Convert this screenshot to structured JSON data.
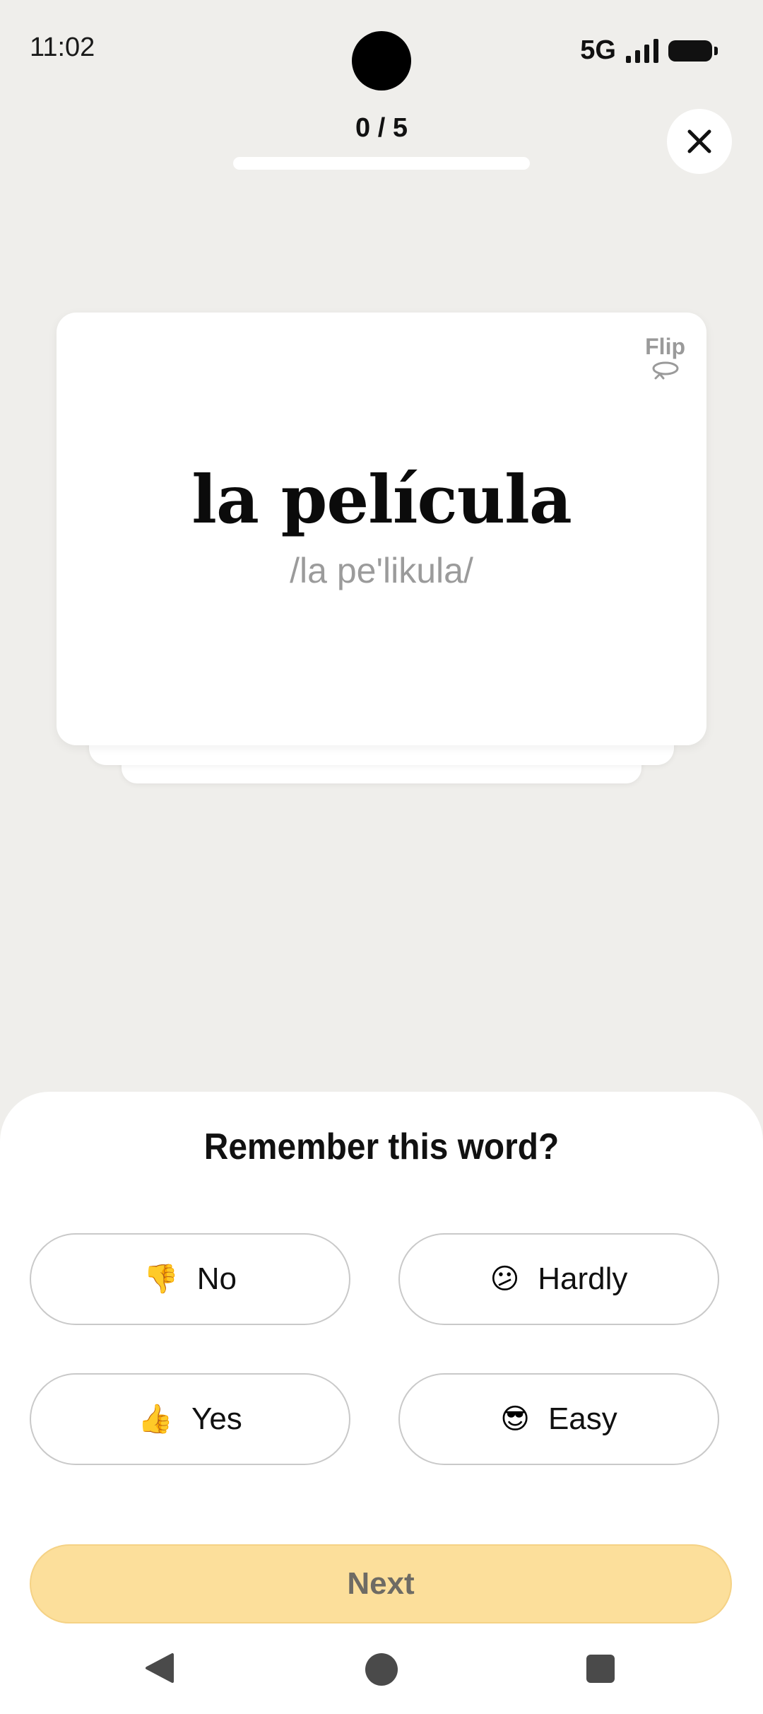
{
  "status_bar": {
    "time": "11:02",
    "network": "5G",
    "icons": [
      "signal-icon",
      "battery-icon"
    ]
  },
  "progress": {
    "text": "0 / 5",
    "completed": 0,
    "total": 5
  },
  "close_icon": "close-icon",
  "card": {
    "word": "la película",
    "phonetic": "/la pe'likula/",
    "flip_label": "Flip",
    "flip_icon": "flip-rotate-icon"
  },
  "sheet": {
    "title": "Remember this word?",
    "choices": [
      {
        "label": "No",
        "emoji": "👎"
      },
      {
        "label": "Hardly",
        "emoji": "😕"
      },
      {
        "label": "Yes",
        "emoji": "👍"
      },
      {
        "label": "Easy",
        "emoji": "😎"
      }
    ],
    "next_label": "Next"
  },
  "colors": {
    "background": "#efeeeb",
    "accent": "#fcdf9b",
    "card": "#ffffff"
  }
}
